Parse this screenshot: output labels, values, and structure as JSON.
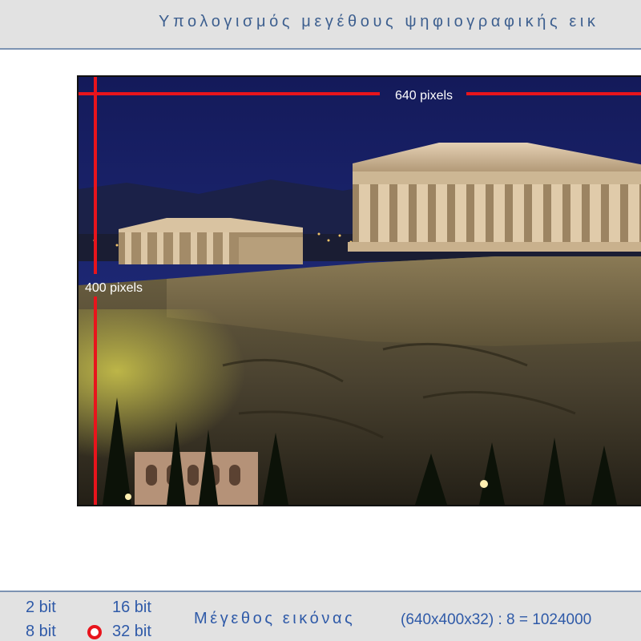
{
  "header": {
    "title": "Υπολογισμός μεγέθους ψηφιογραφικής εικ"
  },
  "image": {
    "width_label": "640 pixels",
    "height_label": "400 pixels",
    "measure_color": "#e8141c"
  },
  "footer": {
    "bit_options": [
      "2 bit",
      "16 bit",
      "8 bit",
      "32 bit"
    ],
    "selected_bit": "32 bit",
    "size_label": "Μέγεθος εικόνας",
    "size_formula": "(640x400x32) : 8 = 1024000"
  },
  "colors": {
    "accent_blue": "#2f5aa8",
    "title_blue": "#3d5f8f",
    "header_bg": "#e2e2e2",
    "radio_red": "#e8141c"
  }
}
